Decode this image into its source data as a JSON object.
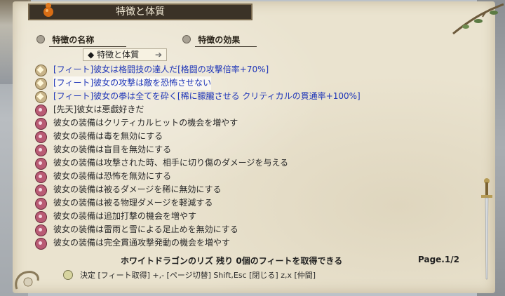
{
  "window": {
    "title": "特徴と体質"
  },
  "columns": {
    "name_header": "特徴の名称",
    "effect_header": "特徴の効果"
  },
  "category": {
    "label": "特徴と体質",
    "bullet": "◆",
    "arrow": "➔"
  },
  "items": [
    {
      "type": "feat",
      "icon": "star-badge-icon",
      "text": "[フィート]彼女は格闘技の達人だ[格闘の攻撃倍率+70%]"
    },
    {
      "type": "feat",
      "icon": "star-badge-icon",
      "text": "[フィート]彼女の攻撃は敵を恐怖させない"
    },
    {
      "type": "feat",
      "icon": "star-badge-icon",
      "text": "[フィート]彼女の拳は全てを砕く[稀に朦朧させる クリティカルの貫通率+100%]"
    },
    {
      "type": "trait",
      "icon": "swirl-badge-icon",
      "text": "[先天]彼女は悪戯好きだ"
    },
    {
      "type": "trait",
      "icon": "swirl-badge-icon",
      "text": "彼女の装備はクリティカルヒットの機会を増やす"
    },
    {
      "type": "trait",
      "icon": "swirl-badge-icon",
      "text": "彼女の装備は毒を無効にする"
    },
    {
      "type": "trait",
      "icon": "swirl-badge-icon",
      "text": "彼女の装備は盲目を無効にする"
    },
    {
      "type": "trait",
      "icon": "swirl-badge-icon",
      "text": "彼女の装備は攻撃された時、相手に切り傷のダメージを与える"
    },
    {
      "type": "trait",
      "icon": "swirl-badge-icon",
      "text": "彼女の装備は恐怖を無効にする"
    },
    {
      "type": "trait",
      "icon": "swirl-badge-icon",
      "text": "彼女の装備は被るダメージを稀に無効にする"
    },
    {
      "type": "trait",
      "icon": "swirl-badge-icon",
      "text": "彼女の装備は被る物理ダメージを軽減する"
    },
    {
      "type": "trait",
      "icon": "swirl-badge-icon",
      "text": "彼女の装備は追加打撃の機会を増やす"
    },
    {
      "type": "trait",
      "icon": "swirl-badge-icon",
      "text": "彼女の装備は雷雨と雪による足止めを無効にする"
    },
    {
      "type": "trait",
      "icon": "swirl-badge-icon",
      "text": "彼女の装備は完全貫通攻撃発動の機会を増やす"
    }
  ],
  "footer": {
    "status": "ホワイトドラゴンのリズ 残り 0個のフィートを取得できる",
    "page": "Page.1/2"
  },
  "help": {
    "text": "決定 [フィート取得]  +,- [ページ切替]  Shift,Esc [閉じる]  z,x [仲間]"
  },
  "colors": {
    "feat_text": "#1f36b8",
    "trait_text": "#2a2a2a",
    "parchment": "#eae3cf",
    "title_bar": "#3b3227"
  }
}
